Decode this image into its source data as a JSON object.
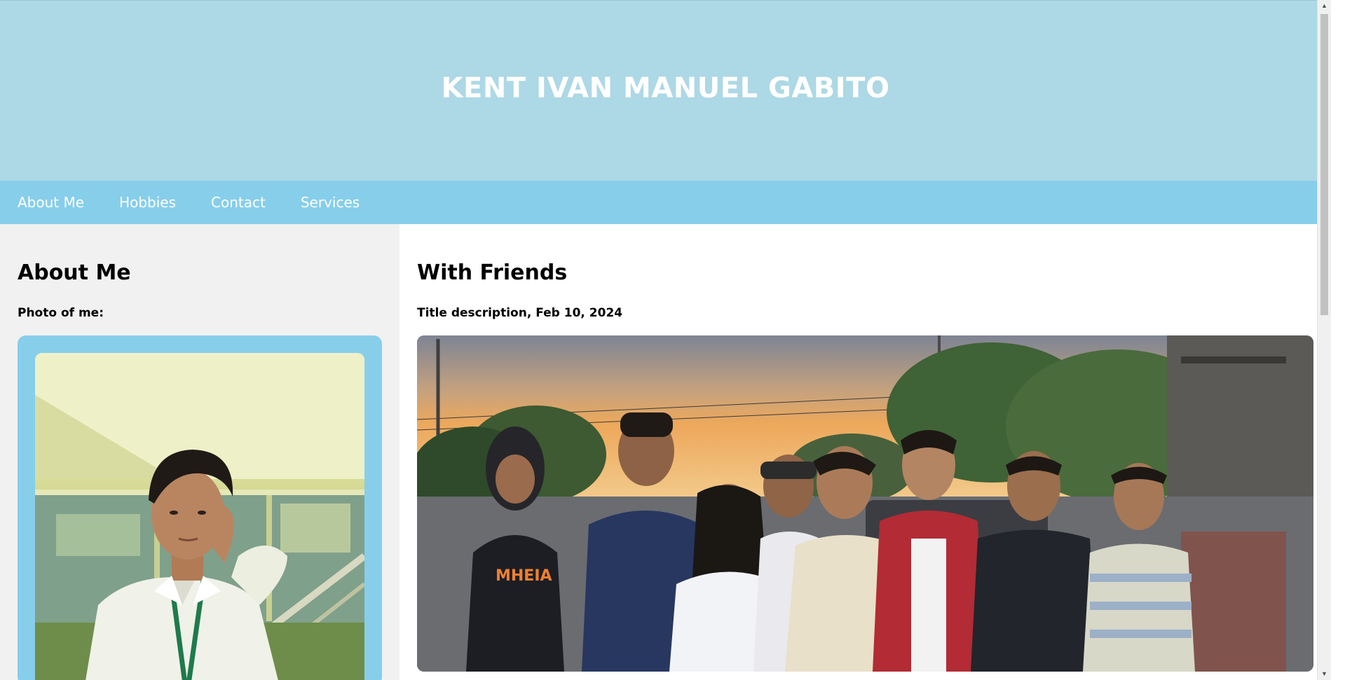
{
  "header": {
    "title": "KENT IVAN MANUEL GABITO"
  },
  "nav": {
    "items": [
      {
        "label": "About Me"
      },
      {
        "label": "Hobbies"
      },
      {
        "label": "Contact"
      },
      {
        "label": "Services"
      }
    ]
  },
  "left": {
    "title": "About Me",
    "subtitle": "Photo of me:"
  },
  "right": {
    "title": "With Friends",
    "subtitle": "Title description, Feb 10, 2024"
  },
  "colors": {
    "header_bg": "#add8e6",
    "nav_bg": "#87ceeb",
    "left_bg": "#f1f1f1",
    "photo_card_bg": "#87ceeb"
  },
  "scrollbar": {
    "up_icon": "chevron-up-icon",
    "down_icon": "chevron-down-icon"
  }
}
